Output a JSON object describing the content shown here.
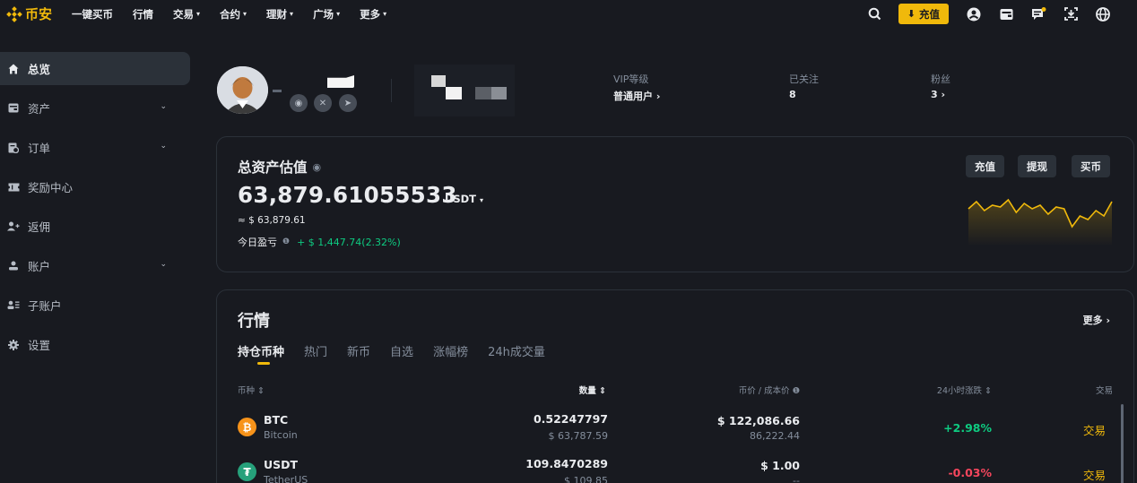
{
  "nav": {
    "logo_text": "币安",
    "items": [
      {
        "label": "一键买币",
        "has_dropdown": false
      },
      {
        "label": "行情",
        "has_dropdown": false
      },
      {
        "label": "交易",
        "has_dropdown": true
      },
      {
        "label": "合约",
        "has_dropdown": true
      },
      {
        "label": "理财",
        "has_dropdown": true
      },
      {
        "label": "广场",
        "has_dropdown": true
      },
      {
        "label": "更多",
        "has_dropdown": true
      }
    ],
    "deposit_label": "充值",
    "right_icons": [
      "search-icon",
      "user-icon",
      "wallet-icon",
      "message-icon",
      "download-icon",
      "globe-icon",
      "theme-icon"
    ]
  },
  "sidebar": {
    "items": [
      {
        "label": "总览",
        "icon": "home-icon",
        "active": true,
        "expandable": false
      },
      {
        "label": "资产",
        "icon": "wallet-icon",
        "active": false,
        "expandable": true
      },
      {
        "label": "订单",
        "icon": "orders-icon",
        "active": false,
        "expandable": true
      },
      {
        "label": "奖励中心",
        "icon": "ticket-icon",
        "active": false,
        "expandable": false
      },
      {
        "label": "返佣",
        "icon": "user-plus-icon",
        "active": false,
        "expandable": false
      },
      {
        "label": "账户",
        "icon": "user-icon",
        "active": false,
        "expandable": true
      },
      {
        "label": "子账户",
        "icon": "sub-account-icon",
        "active": false,
        "expandable": false
      },
      {
        "label": "设置",
        "icon": "gear-icon",
        "active": false,
        "expandable": false
      }
    ]
  },
  "profile": {
    "stats": [
      {
        "label": "VIP等级",
        "value": "普通用户",
        "chevron": "›"
      },
      {
        "label": "已关注",
        "value": "8",
        "chevron": ""
      },
      {
        "label": "粉丝",
        "value": "3",
        "chevron": "›"
      }
    ]
  },
  "assets": {
    "title": "总资产估值",
    "total": "63,879.61055533",
    "unit": "USDT",
    "usd_equiv": "≈ $ 63,879.61",
    "pnl_label": "今日盈亏",
    "pnl_value": "+ $ 1,447.74(2.32%)",
    "buttons": [
      "充值",
      "提现",
      "买币"
    ],
    "sparkline": [
      62,
      58,
      63,
      60,
      61,
      57,
      64,
      59,
      62,
      60,
      65,
      61,
      62,
      72,
      66,
      68,
      63,
      66,
      58
    ],
    "colors": {
      "up": "#0ecb81",
      "down": "#f6465d",
      "accent": "#f0b90b"
    }
  },
  "market": {
    "title": "行情",
    "more": "更多 ›",
    "tabs": [
      "持仓币种",
      "热门",
      "新币",
      "自选",
      "涨幅榜",
      "24h成交量"
    ],
    "headers": {
      "coin": "币种 ⇕",
      "qty": "数量 ⇕",
      "price": "币价 / 成本价 ❶",
      "change": "24小时涨跌 ⇕",
      "trade": "交易"
    },
    "rows": [
      {
        "symbol": "BTC",
        "name": "Bitcoin",
        "icon": "bitcoin-icon",
        "icon_color": "#f7931a",
        "glyph": "₿",
        "qty": "0.52247797",
        "qty_usd": "$ 63,787.59",
        "price": "$ 122,086.66",
        "cost": "86,222.44",
        "change": "+2.98%",
        "change_dir": "up",
        "trade": "交易"
      },
      {
        "symbol": "USDT",
        "name": "TetherUS",
        "icon": "tether-icon",
        "icon_color": "#26a17b",
        "glyph": "₮",
        "qty": "109.8470289",
        "qty_usd": "$ 109.85",
        "price": "$ 1.00",
        "cost": "--",
        "change": "-0.03%",
        "change_dir": "down",
        "trade": "交易"
      }
    ]
  }
}
